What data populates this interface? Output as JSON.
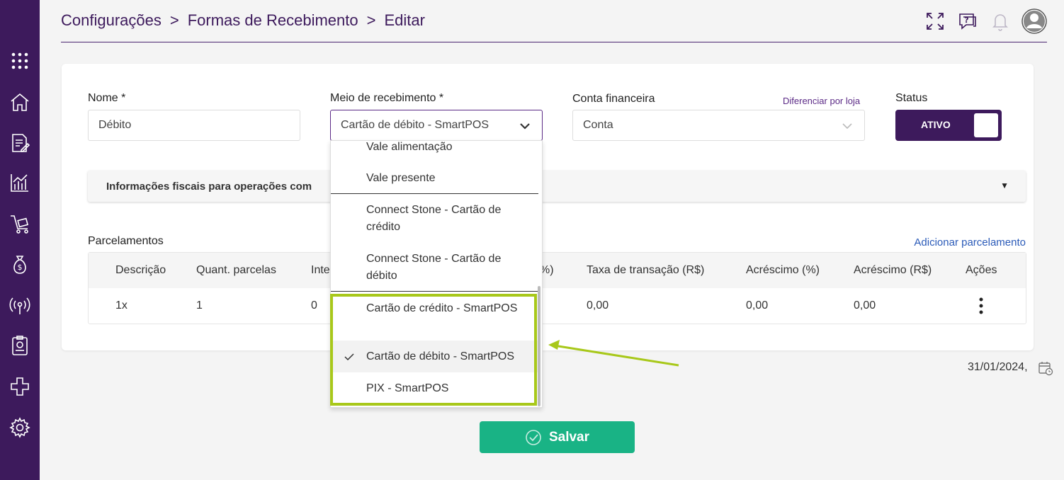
{
  "breadcrumb": {
    "items": [
      "Configurações",
      "Formas de Recebimento",
      "Editar"
    ],
    "separator": ">"
  },
  "header_icons": [
    "expand-icon",
    "help-icon",
    "bell-icon",
    "user-avatar-icon"
  ],
  "sidebar": {
    "items": [
      "apps-grid-icon",
      "home-icon",
      "document-edit-icon",
      "chart-icon",
      "cart-icon",
      "money-bag-icon",
      "antenna-icon",
      "report-icon",
      "plus-network-icon",
      "gear-icon"
    ]
  },
  "form": {
    "nome_label": "Nome *",
    "nome_value": "Débito",
    "meio_label": "Meio de recebimento *",
    "meio_value": "Cartão de débito - SmartPOS",
    "conta_label": "Conta financeira",
    "conta_value": "Conta",
    "diferenciar_link": "Diferenciar por loja",
    "status_label": "Status",
    "status_value": "ATIVO"
  },
  "accordion": {
    "title": "Informações fiscais para operações com"
  },
  "parcelamentos": {
    "title": "Parcelamentos",
    "add_link": "Adicionar parcelamento",
    "columns": [
      "Descrição",
      "Quant. parcelas",
      "Inte",
      "%)",
      "Taxa de transação (R$)",
      "Acréscimo (%)",
      "Acréscimo (R$)",
      "Ações"
    ],
    "rows": [
      {
        "descricao": "1x",
        "quant": "1",
        "inte": "0",
        "taxa_rs": "0,00",
        "acrescimo_pct": "0,00",
        "acrescimo_rs": "0,00"
      }
    ]
  },
  "dropdown": {
    "items": [
      "Vale alimentação",
      "Vale presente",
      "Connect Stone - Cartão de crédito",
      "Connect Stone - Cartão de débito",
      "Cartão de crédito - SmartPOS",
      "Cartão de débito - SmartPOS",
      "PIX - SmartPOS"
    ],
    "selected": "Cartão de débito - SmartPOS"
  },
  "footer": {
    "date": "31/01/2024,",
    "save_label": "Salvar"
  },
  "colors": {
    "sidebar": "#3d1a5c",
    "accent": "#5b2a86",
    "save": "#19b385",
    "highlight": "#a8c81a",
    "link": "#2a5ab8"
  }
}
